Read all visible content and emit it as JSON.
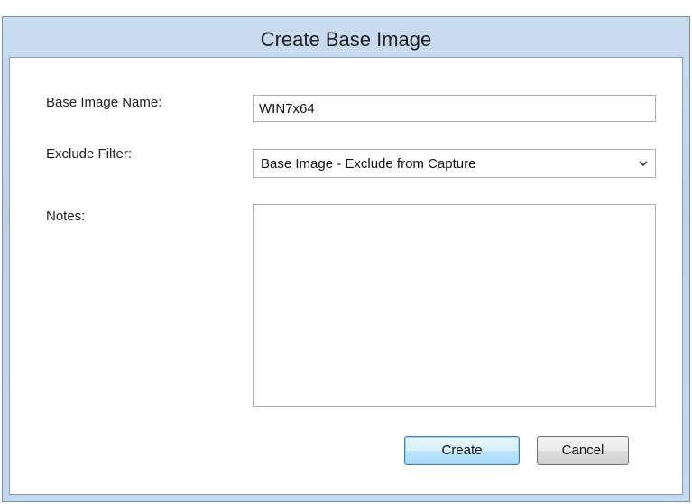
{
  "dialog": {
    "title": "Create Base Image"
  },
  "form": {
    "base_image_name_label": "Base Image Name:",
    "base_image_name_value": "WIN7x64",
    "exclude_filter_label": "Exclude Filter:",
    "exclude_filter_value": "Base Image - Exclude from Capture",
    "notes_label": "Notes:",
    "notes_value": ""
  },
  "buttons": {
    "create_label": "Create",
    "cancel_label": "Cancel"
  },
  "icons": {
    "dropdown": "chevron-down-icon"
  },
  "colors": {
    "frame": "#c9dcf0",
    "default_button_border": "#3c7fb1"
  }
}
